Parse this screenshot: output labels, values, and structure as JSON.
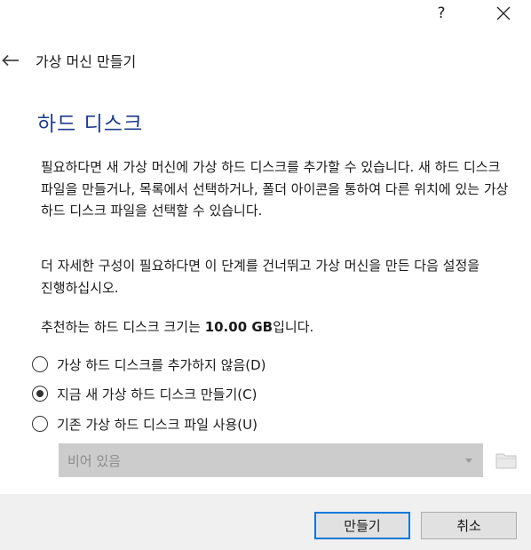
{
  "titlebar": {
    "help_label": "?",
    "close_icon": "close-icon"
  },
  "header": {
    "back_icon": "arrow-left-icon",
    "title": "가상 머신 만들기"
  },
  "page": {
    "title": "하드 디스크",
    "paragraph1": "필요하다면 새 가상 머신에 가상 하드 디스크를 추가할 수 있습니다. 새 하드 디스크 파일을 만들거나, 목록에서 선택하거나, 폴더 아이콘을 통하여 다른 위치에 있는 가상 하드 디스크 파일을 선택할 수 있습니다.",
    "paragraph2": "더 자세한 구성이 필요하다면 이 단계를 건너뛰고 가상 머신을 만든 다음 설정을 진행하십시오.",
    "recommend_prefix": "추천하는 하드 디스크 크기는 ",
    "recommend_size": "10.00 GB",
    "recommend_suffix": "입니다."
  },
  "options": [
    {
      "label": "가상 하드 디스크를 추가하지 않음(D)",
      "selected": false
    },
    {
      "label": "지금 새 가상 하드 디스크 만들기(C)",
      "selected": true
    },
    {
      "label": "기존 가상 하드 디스크 파일 사용(U)",
      "selected": false
    }
  ],
  "existing_disk": {
    "selected_value": "비어 있음",
    "dropdown_icon": "chevron-down-icon",
    "folder_icon": "folder-icon"
  },
  "buttons": {
    "create": "만들기",
    "cancel": "취소"
  },
  "colors": {
    "title_blue": "#1e3e8c",
    "default_button_border": "#0a78d7",
    "disabled_combo_bg": "#cccccc",
    "footer_bg": "#f0f0f0"
  }
}
